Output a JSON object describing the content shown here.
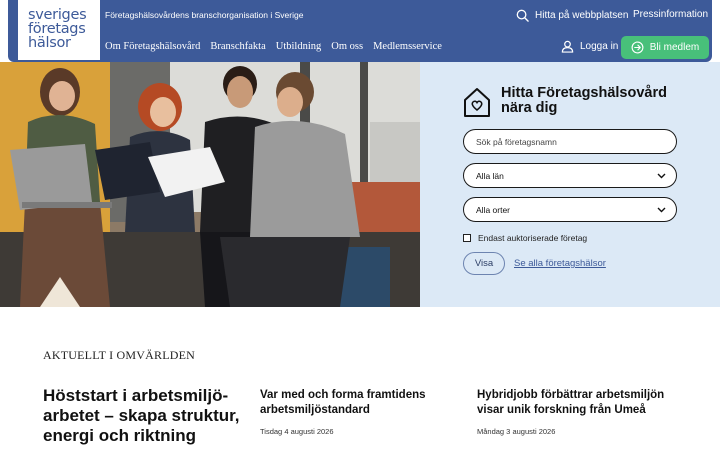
{
  "header": {
    "logo": {
      "line1": "sveriges",
      "line2": "företags",
      "line3": "hälsor"
    },
    "tagline": "Företagshälsovårdens branschorganisation i Sverige",
    "search_link": "Hitta på webbplatsen",
    "press_link": "Pressinformation",
    "nav": [
      "Om Företagshälsovård",
      "Branschfakta",
      "Utbildning",
      "Om oss",
      "Medlemsservice"
    ],
    "login": "Logga in",
    "member_button": "Bli medlem",
    "colors": {
      "header_bg": "#3d5a99",
      "member_bg": "#48c07a"
    }
  },
  "finder": {
    "title_line1": "Hitta Företagshälsovård",
    "title_line2": "nära dig",
    "name_placeholder": "Sök på företagsnamn",
    "county_select": "Alla län",
    "city_select": "Alla orter",
    "checkbox_label": "Endast auktoriserade företag",
    "show_button": "Visa",
    "see_all_link": "Se alla företagshälsor",
    "panel_bg": "#dce9f6"
  },
  "news": {
    "heading": "AKTUELLT I OMVÄRLDEN",
    "items": [
      {
        "title": "Höststart i arbetsmiljö-arbetet – skapa struktur, energi och riktning",
        "date": ""
      },
      {
        "title": "Var med och forma framtidens arbetsmiljöstandard",
        "date": "Tisdag 4 augusti 2026"
      },
      {
        "title": "Hybridjobb förbättrar arbetsmiljön visar unik forskning från Umeå",
        "date": "Måndag 3 augusti 2026"
      }
    ]
  }
}
